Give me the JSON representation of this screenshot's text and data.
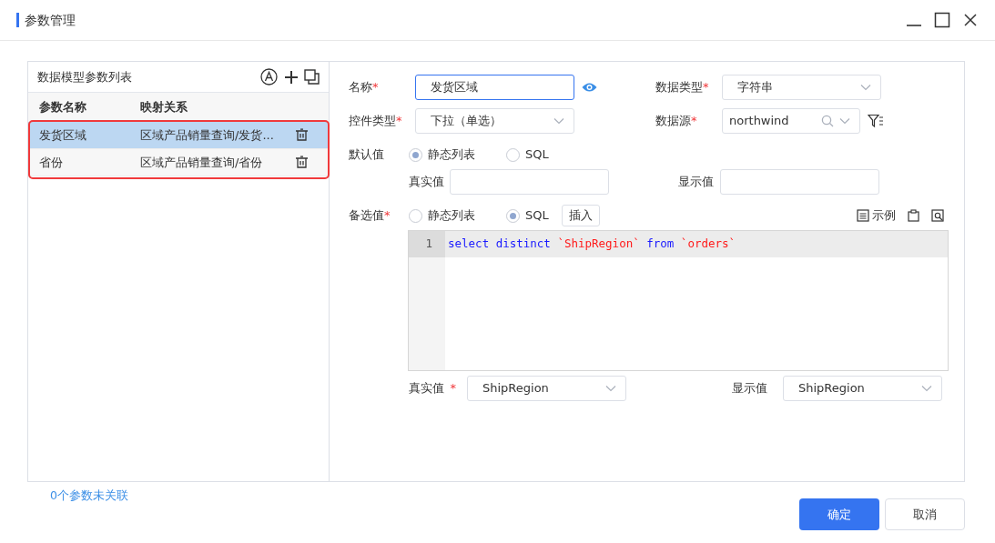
{
  "window": {
    "title": "参数管理"
  },
  "param_list": {
    "title": "数据模型参数列表",
    "columns": [
      "参数名称",
      "映射关系"
    ],
    "rows": [
      {
        "name": "发货区域",
        "mapping": "区域产品销量查询/发货...",
        "selected": true
      },
      {
        "name": "省份",
        "mapping": "区域产品销量查询/省份",
        "selected": false
      }
    ],
    "highlighted": true
  },
  "form": {
    "name": {
      "label": "名称",
      "required_mark": "*",
      "value": "发货区域"
    },
    "data_type": {
      "label": "数据类型",
      "required_mark": "*",
      "value": "字符串"
    },
    "control_type": {
      "label": "控件类型",
      "required_mark": "*",
      "value": "下拉（单选）"
    },
    "data_source": {
      "label": "数据源",
      "required_mark": "*",
      "value": "northwind"
    },
    "default_value": {
      "label": "默认值",
      "options": [
        {
          "label": "静态列表",
          "selected": true
        },
        {
          "label": "SQL",
          "selected": false
        }
      ],
      "real_label": "真实值",
      "display_label": "显示值"
    },
    "candidates": {
      "label": "备选值",
      "required_mark": "*",
      "options": [
        {
          "label": "静态列表",
          "selected": false
        },
        {
          "label": "SQL",
          "selected": true
        }
      ],
      "insert_button": "插入",
      "example_button": "示例",
      "code": [
        {
          "number": "1",
          "active": true,
          "tokens": [
            {
              "text": "select",
              "kind": "keyword"
            },
            {
              "text": "distinct",
              "kind": "keyword"
            },
            {
              "text": "`ShipRegion`",
              "kind": "string"
            },
            {
              "text": "from",
              "kind": "keyword"
            },
            {
              "text": "`orders`",
              "kind": "string"
            }
          ]
        }
      ],
      "real_value": {
        "label": "真实值",
        "required_mark": "*",
        "value": "ShipRegion"
      },
      "display_value": {
        "label": "显示值",
        "value": "ShipRegion"
      }
    }
  },
  "footer": {
    "link": "0个参数未关联",
    "buttons": [
      {
        "label": "确定",
        "kind": "primary"
      },
      {
        "label": "取消",
        "kind": "secondary"
      }
    ]
  }
}
